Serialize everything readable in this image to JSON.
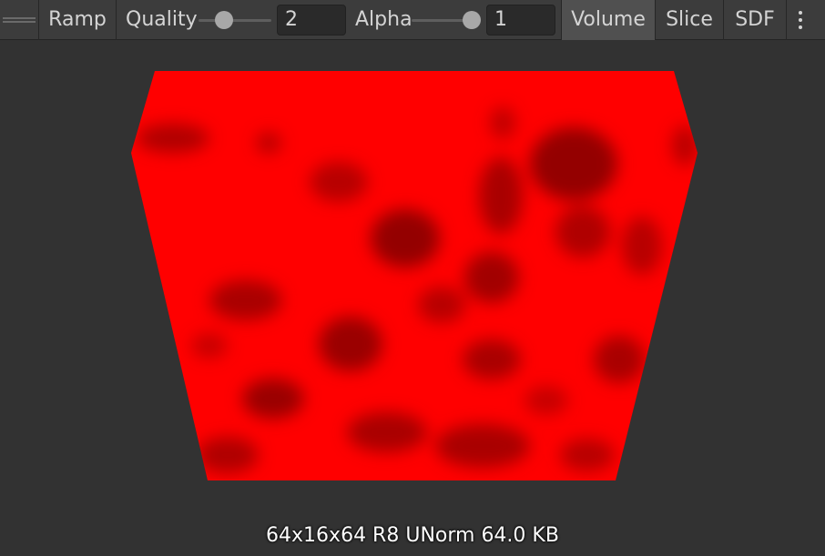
{
  "toolbar": {
    "ramp_label": "Ramp",
    "quality_label": "Quality",
    "quality_value": "2",
    "quality_slider_fraction": 0.3,
    "alpha_label": "Alpha",
    "alpha_value": "1",
    "alpha_slider_fraction": 1.0,
    "volume_label": "Volume",
    "volume_active": true,
    "slice_label": "Slice",
    "sdf_label": "SDF",
    "more_icon": "kebab-menu-icon",
    "drag_icon": "drag-handle-icon"
  },
  "preview": {
    "info_text": "64x16x64 R8 UNorm 64.0 KB",
    "volume_color": "#ff0000",
    "shadow_color": "#700000"
  },
  "colors": {
    "toolbar_bg": "#3c3c3c",
    "viewport_bg": "#323232",
    "active_tab_bg": "#505050"
  }
}
